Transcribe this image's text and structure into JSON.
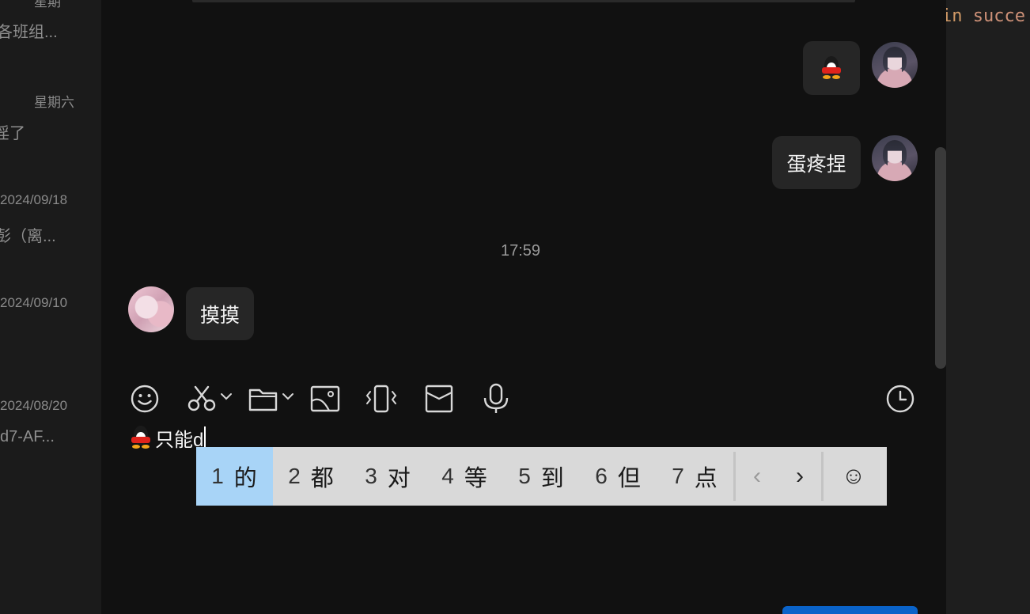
{
  "sidebar": {
    "conversations": [
      {
        "date": "星期",
        "preview": "各班组..."
      },
      {
        "date": "星期六",
        "preview": "淫了"
      },
      {
        "date": "2024/09/18",
        "preview": "彭（离..."
      },
      {
        "date": "2024/09/10",
        "preview": ""
      },
      {
        "date": "2024/08/20",
        "preview": "d7-AF..."
      }
    ]
  },
  "chat": {
    "messages": [
      {
        "sender": "self",
        "type": "sticker",
        "sticker": "penguin-icon"
      },
      {
        "sender": "self",
        "type": "text",
        "text": "蛋疼捏"
      },
      {
        "sender": "other",
        "type": "text",
        "text": "摸摸"
      }
    ],
    "timestamp": "17:59"
  },
  "toolbar": {
    "items": [
      "smiley-icon",
      "scissors-icon",
      "folder-icon",
      "image-icon",
      "shake-icon",
      "red-packet-icon",
      "microphone-icon",
      "history-clock-icon"
    ]
  },
  "input": {
    "text": "只能d",
    "prefix_icon": "penguin-icon"
  },
  "ime": {
    "candidates": [
      {
        "num": "1",
        "char": "的"
      },
      {
        "num": "2",
        "char": "都"
      },
      {
        "num": "3",
        "char": "对"
      },
      {
        "num": "4",
        "char": "等"
      },
      {
        "num": "5",
        "char": "到"
      },
      {
        "num": "6",
        "char": "但"
      },
      {
        "num": "7",
        "char": "点"
      }
    ],
    "selected_index": 0,
    "prev": "‹",
    "next": "›",
    "emoji": "☺"
  },
  "code_window": {
    "line_keyword": "in",
    "line_ident": "succe"
  },
  "colors": {
    "background": "#111111",
    "bubble": "#262626",
    "ime_selected": "#a8d4f7",
    "send_button": "#0a63c9"
  }
}
